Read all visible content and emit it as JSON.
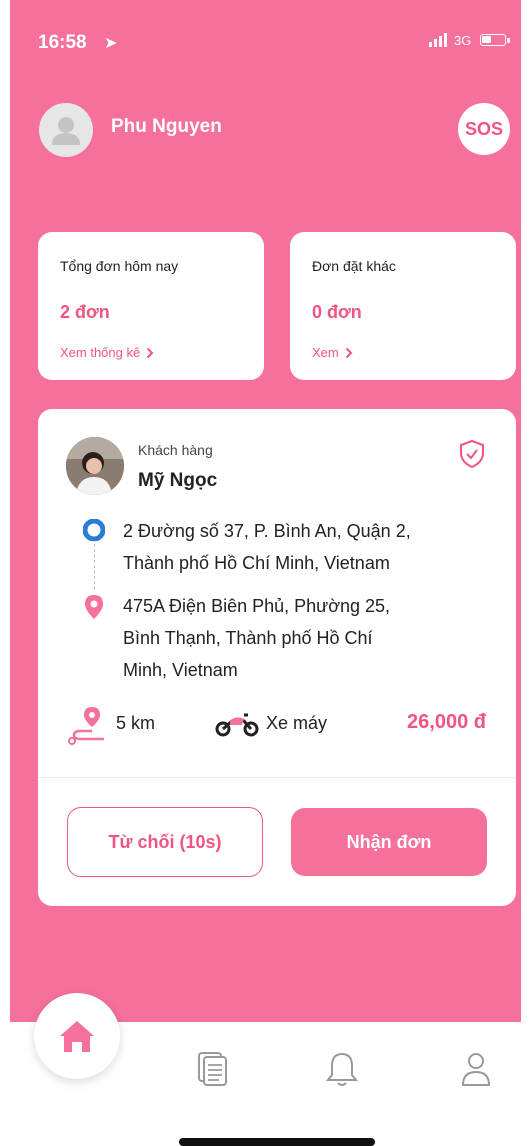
{
  "status_bar": {
    "time": "16:58",
    "network": "3G"
  },
  "header": {
    "user_name": "Phu Nguyen",
    "sos_label": "SOS"
  },
  "stats": [
    {
      "label": "Tổng đơn hôm nay",
      "value": "2 đơn",
      "link": "Xem thống kê"
    },
    {
      "label": "Đơn đặt khác",
      "value": "0 đơn",
      "link": "Xem"
    }
  ],
  "order": {
    "customer_label": "Khách hàng",
    "customer_name": "Mỹ Ngọc",
    "pickup_address_line1": "2 Đường số 37, P. Bình An, Quận 2,",
    "pickup_address_line2": "Thành phố Hồ Chí Minh, Vietnam",
    "dropoff_address_line1": "475A Điện Biên Phủ, Phường 25,",
    "dropoff_address_line2": "Bình Thạnh, Thành phố Hồ Chí",
    "dropoff_address_line3": "Minh, Vietnam",
    "distance": "5 km",
    "vehicle": "Xe máy",
    "price": "26,000 đ",
    "reject_label": "Từ chối (10s)",
    "accept_label": "Nhận đơn"
  },
  "nav": {
    "items": [
      "home-icon",
      "orders-icon",
      "bell-icon",
      "profile-icon"
    ],
    "active": "home-icon"
  },
  "colors": {
    "primary": "#f5719a",
    "accent_text": "#f0557f",
    "white": "#ffffff"
  }
}
